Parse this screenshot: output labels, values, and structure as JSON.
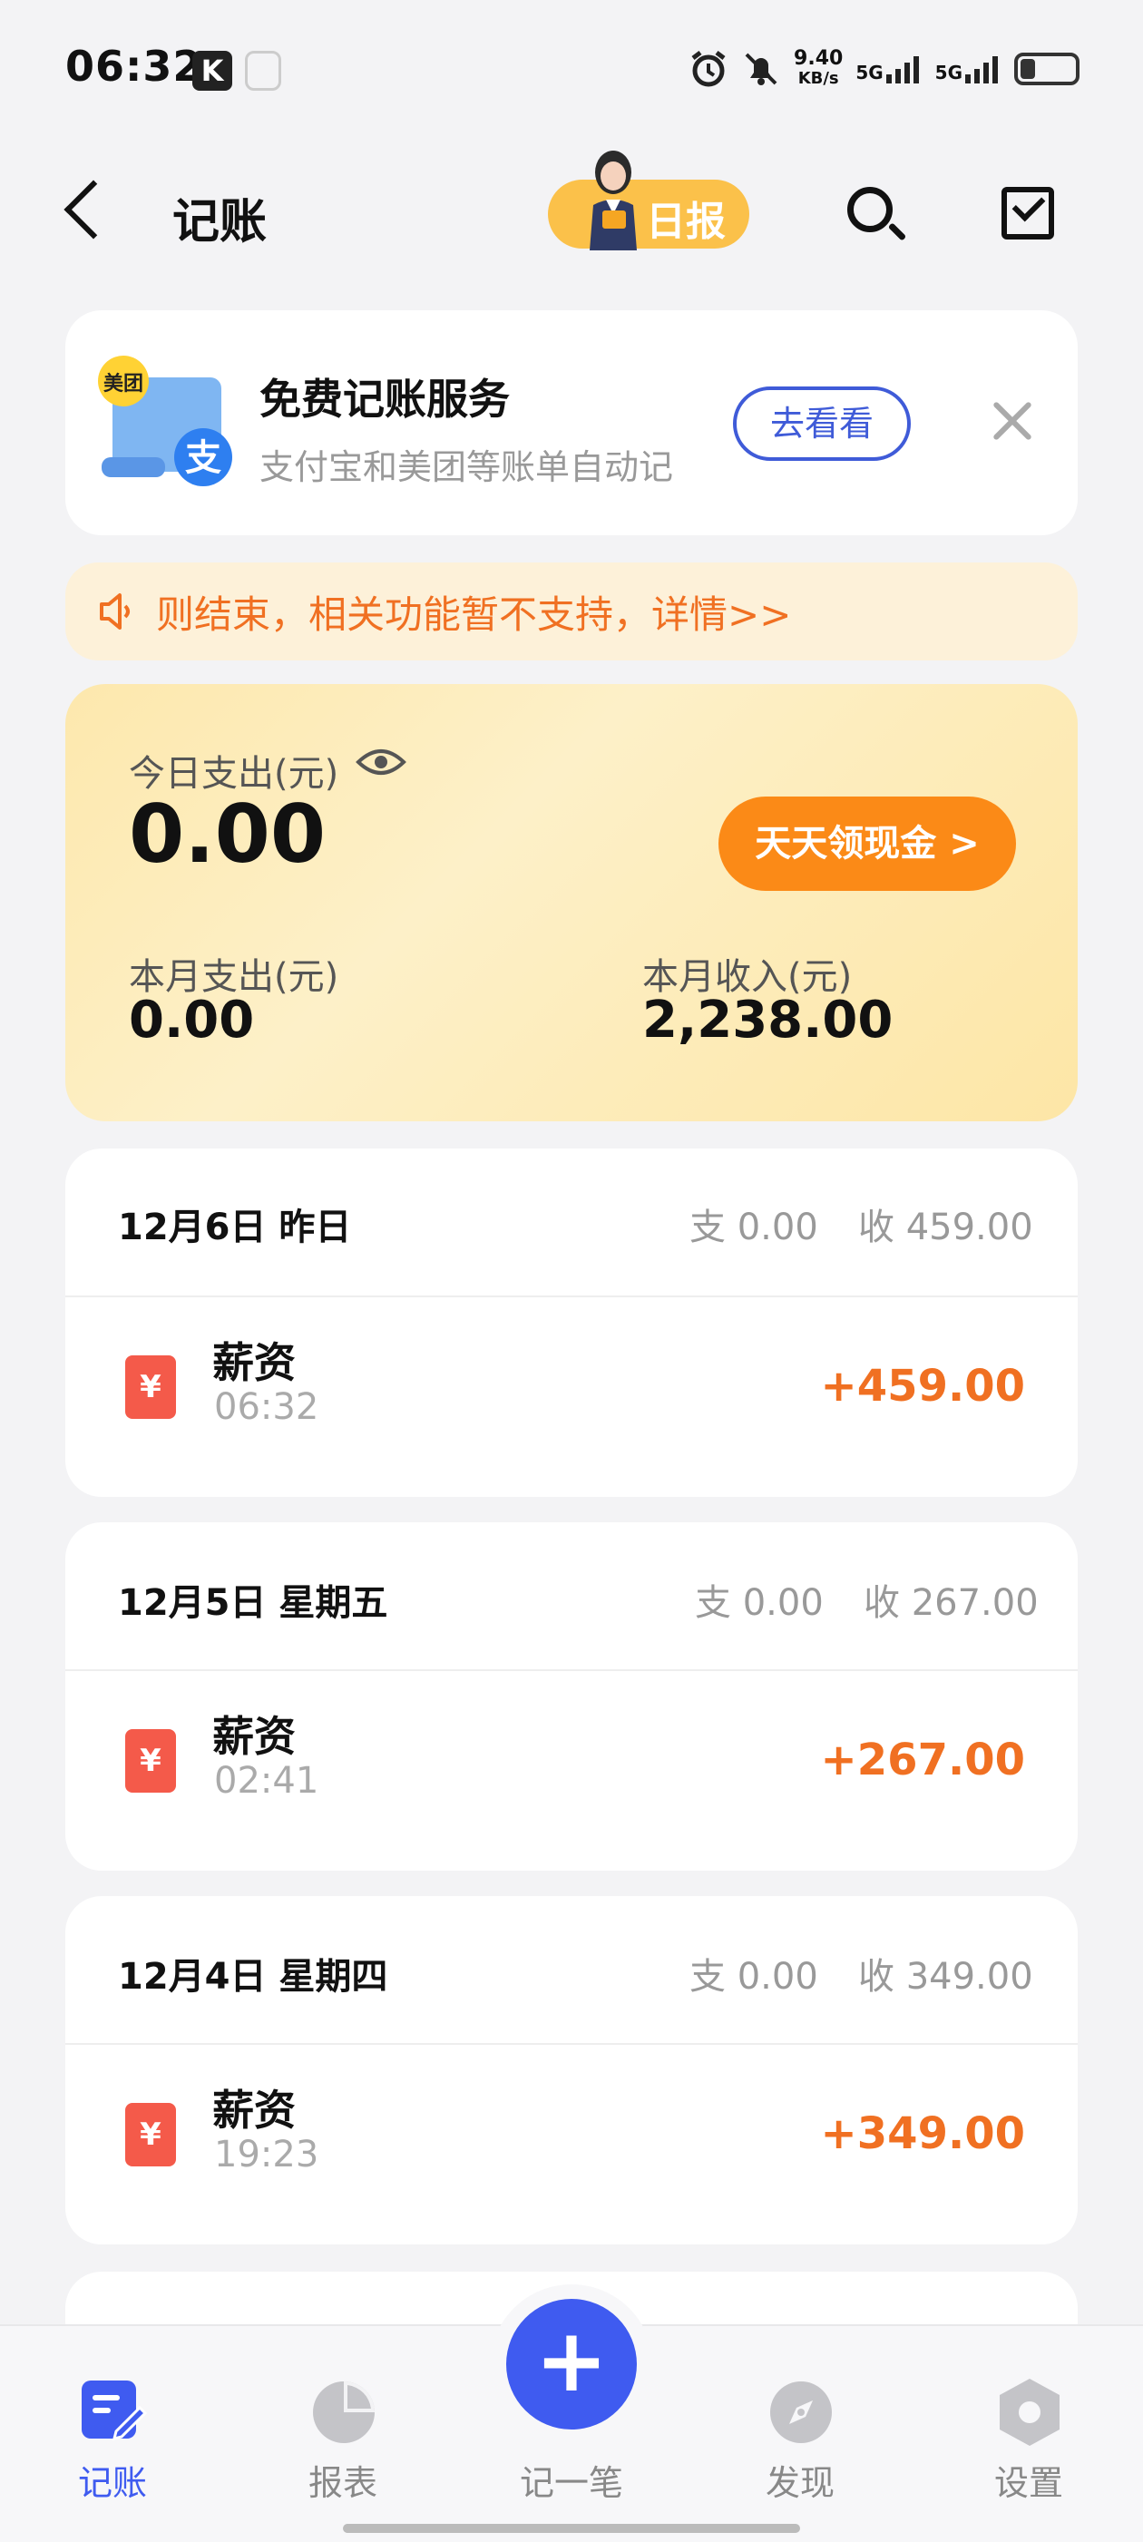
{
  "status_bar": {
    "time": "06:32",
    "k_badge": "K",
    "net_speed_value": "9.40",
    "net_speed_unit": "KB/s",
    "sim1": "5G",
    "sim2": "5G"
  },
  "header": {
    "title": "记账",
    "daily_report_label": "日报"
  },
  "promo": {
    "badge": "美团",
    "title": "免费记账服务",
    "subtitle": "支付宝和美团等账单自动记",
    "button": "去看看"
  },
  "notice": {
    "text": "则结束，相关功能暂不支持，详情>>"
  },
  "summary": {
    "today_label": "今日支出(元)",
    "today_value": "0.00",
    "cash_button": "天天领现金 >",
    "month_expense_label": "本月支出(元)",
    "month_expense_value": "0.00",
    "month_income_label": "本月收入(元)",
    "month_income_value": "2,238.00"
  },
  "days": [
    {
      "date": "12月6日  昨日",
      "expense": "支 0.00",
      "income": "收 459.00",
      "item": {
        "icon": "¥",
        "name": "薪资",
        "time": "06:32",
        "amount": "+459.00"
      }
    },
    {
      "date": "12月5日  星期五",
      "expense": "支 0.00",
      "income": "收 267.00",
      "item": {
        "icon": "¥",
        "name": "薪资",
        "time": "02:41",
        "amount": "+267.00"
      }
    },
    {
      "date": "12月4日  星期四",
      "expense": "支 0.00",
      "income": "收 349.00",
      "item": {
        "icon": "¥",
        "name": "薪资",
        "time": "19:23",
        "amount": "+349.00"
      }
    }
  ],
  "nav": {
    "items": [
      {
        "label": "记账",
        "icon": "ledger-icon",
        "active": true
      },
      {
        "label": "报表",
        "icon": "pie-chart-icon",
        "active": false
      },
      {
        "label": "记一笔",
        "icon": "plus-icon",
        "active": false
      },
      {
        "label": "发现",
        "icon": "compass-icon",
        "active": false
      },
      {
        "label": "设置",
        "icon": "hexagon-settings-icon",
        "active": false
      }
    ],
    "fab_symbol": "+"
  },
  "colors": {
    "accent": "#3f5bf0",
    "income": "#f07022",
    "daily_badge": "#fbc14a",
    "cash_button": "#fb8a17",
    "yen_icon": "#f45a4a"
  }
}
